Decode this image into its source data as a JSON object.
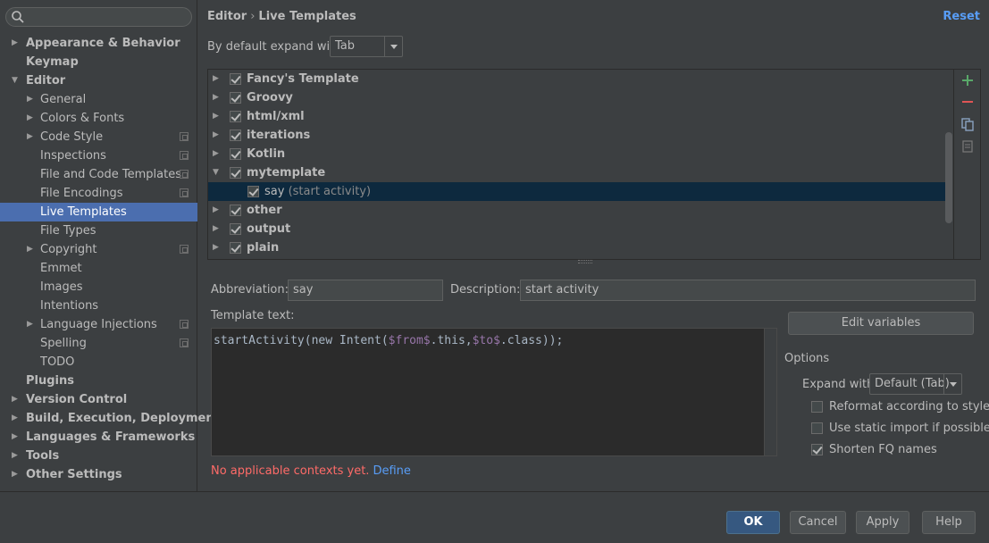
{
  "sidebar": {
    "items": [
      {
        "label": "Appearance & Behavior"
      },
      {
        "label": "Keymap"
      },
      {
        "label": "Editor"
      },
      {
        "label": "General"
      },
      {
        "label": "Colors & Fonts"
      },
      {
        "label": "Code Style"
      },
      {
        "label": "Inspections"
      },
      {
        "label": "File and Code Templates"
      },
      {
        "label": "File Encodings"
      },
      {
        "label": "Live Templates"
      },
      {
        "label": "File Types"
      },
      {
        "label": "Copyright"
      },
      {
        "label": "Emmet"
      },
      {
        "label": "Images"
      },
      {
        "label": "Intentions"
      },
      {
        "label": "Language Injections"
      },
      {
        "label": "Spelling"
      },
      {
        "label": "TODO"
      },
      {
        "label": "Plugins"
      },
      {
        "label": "Version Control"
      },
      {
        "label": "Build, Execution, Deployment"
      },
      {
        "label": "Languages & Frameworks"
      },
      {
        "label": "Tools"
      },
      {
        "label": "Other Settings"
      }
    ]
  },
  "header": {
    "breadcrumb_parent": "Editor",
    "breadcrumb_sep": "›",
    "breadcrumb_current": "Live Templates",
    "reset": "Reset"
  },
  "expand": {
    "label": "By default expand with",
    "value": "Tab"
  },
  "templates": [
    {
      "name": "Fancy's Template",
      "checked": true
    },
    {
      "name": "Groovy",
      "checked": true
    },
    {
      "name": "html/xml",
      "checked": true
    },
    {
      "name": "iterations",
      "checked": true
    },
    {
      "name": "Kotlin",
      "checked": true
    },
    {
      "name": "mytemplate",
      "checked": true
    },
    {
      "name": "say",
      "desc": "(start activity)",
      "checked": true
    },
    {
      "name": "other",
      "checked": true
    },
    {
      "name": "output",
      "checked": true
    },
    {
      "name": "plain",
      "checked": true
    }
  ],
  "form": {
    "abbreviation_label": "Abbreviation:",
    "abbreviation_value": "say",
    "description_label": "Description:",
    "description_value": "start activity",
    "template_text_label": "Template text:",
    "edit_variables": "Edit variables",
    "code_part1": "startActivity(new Intent(",
    "code_var1": "$from$",
    "code_part2": ".this,",
    "code_var2": "$to$",
    "code_part3": ".class));",
    "no_context": "No applicable contexts yet.",
    "define": "Define"
  },
  "options": {
    "title": "Options",
    "expand_label": "Expand with",
    "expand_value": "Default (Tab)",
    "reformat": "Reformat according to style",
    "static_import": "Use static import if possible",
    "shorten": "Shorten FQ names"
  },
  "footer": {
    "ok": "OK",
    "cancel": "Cancel",
    "apply": "Apply",
    "help": "Help"
  },
  "colors": {
    "accent": "#4b6eaf",
    "link": "#589df6",
    "error": "#ff6b68"
  }
}
